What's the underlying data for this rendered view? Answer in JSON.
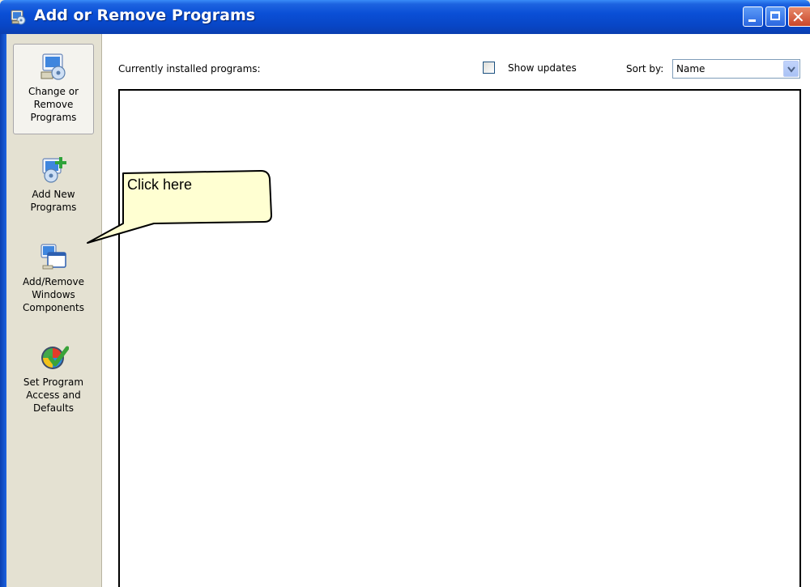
{
  "window": {
    "title": "Add or Remove Programs",
    "icon": "add-remove-programs-icon",
    "controls": [
      "minimize",
      "maximize",
      "close"
    ],
    "colors": {
      "titlebar": "#0a4fd6",
      "sidebar": "#e4e1d2",
      "close_button": "#c8462a"
    }
  },
  "sidebar": {
    "items": [
      {
        "label": "Change or\nRemove\nPrograms",
        "icon": "change-remove-programs-icon",
        "selected": true
      },
      {
        "label": "Add New\nPrograms",
        "icon": "add-new-programs-icon",
        "selected": false
      },
      {
        "label": "Add/Remove\nWindows\nComponents",
        "icon": "windows-components-icon",
        "selected": false
      },
      {
        "label": "Set Program\nAccess and\nDefaults",
        "icon": "program-access-defaults-icon",
        "selected": false
      }
    ]
  },
  "main": {
    "installed_label": "Currently installed programs:",
    "show_updates_label": "Show updates",
    "show_updates_checked": false,
    "sort_by_label": "Sort by:",
    "sort_by_value": "Name"
  },
  "callout": {
    "text": "Click here"
  }
}
